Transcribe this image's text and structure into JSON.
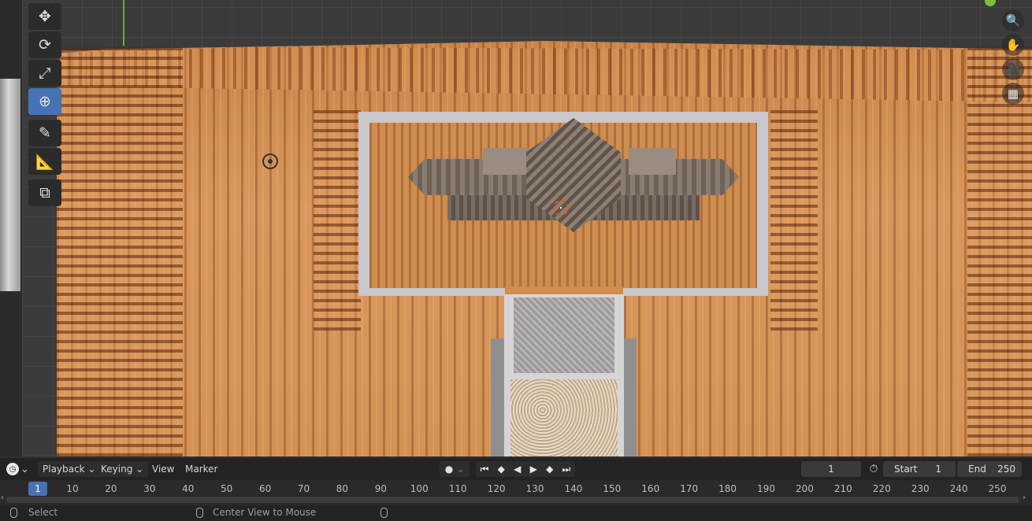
{
  "tools": {
    "move": "move-icon",
    "rotate": "rotate-icon",
    "scale": "scale-icon",
    "transform": "transform-icon",
    "annotate": "annotate-icon",
    "measure": "measure-icon",
    "add_cube": "add-cube-icon"
  },
  "nav_gizmo": [
    "zoom-icon",
    "hand-icon",
    "camera-icon",
    "grid-icon"
  ],
  "timeline": {
    "menus": {
      "playback": "Playback",
      "keying": "Keying",
      "view": "View",
      "marker": "Marker"
    },
    "current_frame": "1",
    "start_label": "Start",
    "start_value": "1",
    "end_label": "End",
    "end_value": "250",
    "ticks": [
      "1",
      "10",
      "20",
      "30",
      "40",
      "50",
      "60",
      "70",
      "80",
      "90",
      "100",
      "110",
      "120",
      "130",
      "140",
      "150",
      "160",
      "170",
      "180",
      "190",
      "200",
      "210",
      "220",
      "230",
      "240",
      "250"
    ]
  },
  "status_bar": {
    "left": "Select",
    "middle": "Center View to Mouse"
  },
  "colors": {
    "accent": "#4772b3",
    "cursor": "#e8501e",
    "axis_y": "#6fa83a"
  }
}
